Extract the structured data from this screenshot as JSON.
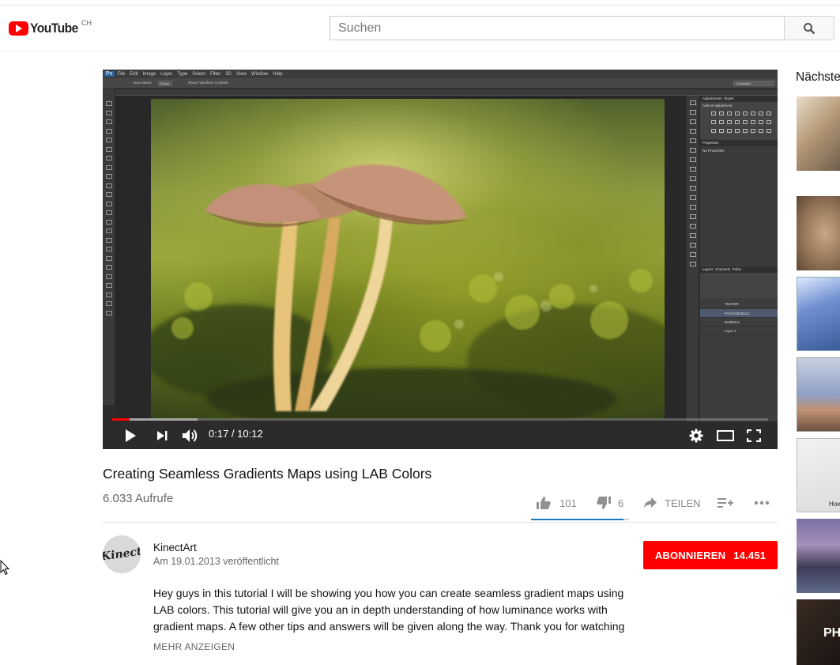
{
  "masthead": {
    "logo_text": "YouTube",
    "country_code": "CH",
    "search_placeholder": "Suchen"
  },
  "player": {
    "time_display": "0:17 / 10:12",
    "progress_played_fraction": 0.027,
    "progress_loaded_fraction": 0.13,
    "photoshop": {
      "menu_items": [
        "File",
        "Edit",
        "Image",
        "Layer",
        "Type",
        "Select",
        "Filter",
        "3D",
        "View",
        "Window",
        "Help"
      ],
      "option_labels": [
        "Auto-Select:",
        "Group",
        "Show Transform Controls"
      ],
      "workspace": "Essentials",
      "panel_tabs_top": [
        "Adjustments",
        "Styles"
      ],
      "adjustments_hint": "Add an adjustment",
      "properties_tab": "Properties",
      "properties_hint": "No Properties",
      "layers_tabs": [
        "Layers",
        "Channels",
        "Paths"
      ],
      "layers": [
        {
          "name": "TESTER",
          "selected": false
        },
        {
          "name": "PSYCHEDELIC",
          "selected": true
        },
        {
          "name": "NORMAL",
          "selected": false
        },
        {
          "name": "Layer 1",
          "selected": false
        }
      ]
    }
  },
  "video": {
    "title": "Creating Seamless Gradients Maps using LAB Colors",
    "views": "6.033 Aufrufe",
    "likes": "101",
    "dislikes": "6",
    "share_label": "TEILEN",
    "like_fraction": 0.944
  },
  "channel": {
    "name": "KinectArt",
    "published": "Am 19.01.2013 veröffentlicht",
    "avatar_text": "Kinect",
    "subscribe_label": "ABONNIEREN",
    "subscriber_count": "14.451"
  },
  "description": {
    "lines": [
      "Hey guys in this tutorial I will be showing you how you can create seamless gradient maps using",
      "LAB colors. This tutorial will give you an in depth understanding of how luminance works with",
      "gradient maps. A few other tips and answers will be given along the way. Thank you for watching"
    ],
    "more_label": "MEHR ANZEIGEN"
  },
  "sidebar": {
    "title": "Nächste",
    "thumb_text": "PH",
    "thumb_text_2": "How"
  },
  "colors": {
    "youtube_red": "#ff0000",
    "like_blue": "#167ac6",
    "photoshop_bg": "#3c3c3c"
  }
}
